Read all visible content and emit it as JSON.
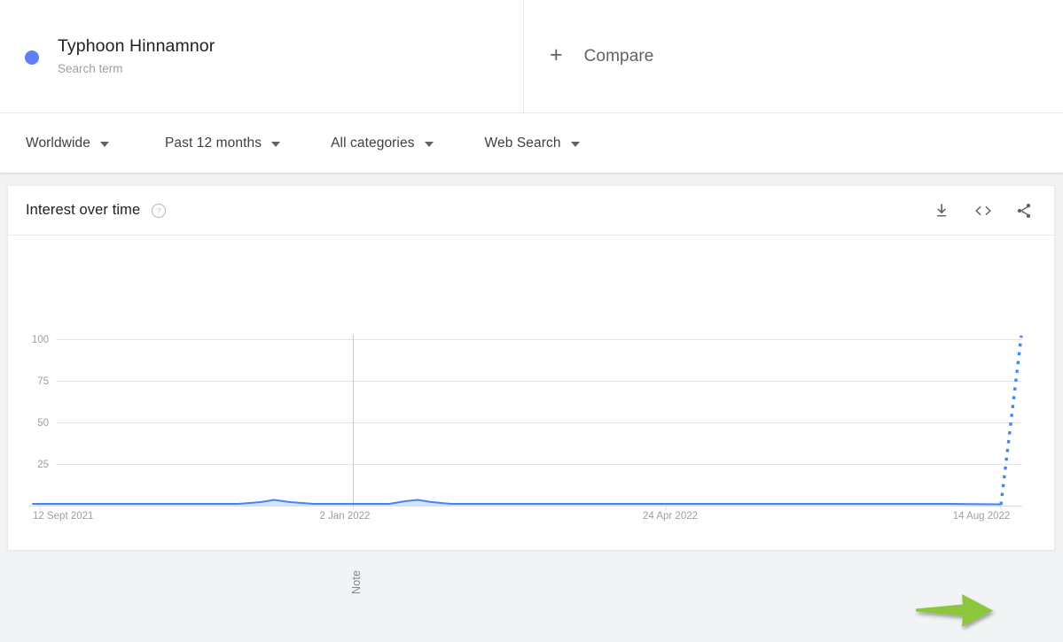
{
  "term": {
    "name": "Typhoon Hinnamnor",
    "type_label": "Search term",
    "dot_color": "#5f80f2"
  },
  "compare": {
    "plus_glyph": "+",
    "label": "Compare"
  },
  "filters": [
    {
      "label": "Worldwide",
      "icon": "chevron-down-icon"
    },
    {
      "label": "Past 12 months",
      "icon": "chevron-down-icon"
    },
    {
      "label": "All categories",
      "icon": "chevron-down-icon"
    },
    {
      "label": "Web Search",
      "icon": "chevron-down-icon"
    }
  ],
  "card": {
    "title": "Interest over time",
    "help_icon": "help-circle-icon",
    "actions": [
      {
        "name": "download-icon",
        "label": "Download"
      },
      {
        "name": "embed-code-icon",
        "label": "Embed"
      },
      {
        "name": "share-icon",
        "label": "Share"
      }
    ]
  },
  "annotation": {
    "note_label": "Note",
    "arrow_color": "#8cc63e",
    "arrow_name": "green-highlight-arrow"
  },
  "chart_data": {
    "type": "line",
    "title": "Interest over time",
    "series": [
      {
        "name": "Typhoon Hinnamnor",
        "color": "#4285f4",
        "values": [
          1,
          1,
          1,
          1,
          1,
          1,
          1,
          1,
          1,
          1,
          1,
          1,
          1,
          1,
          2,
          3,
          2,
          1,
          1,
          1,
          1,
          1,
          1,
          1,
          1,
          1,
          1,
          1,
          1,
          2,
          3,
          2,
          1,
          1,
          1,
          1,
          1,
          1,
          1,
          1,
          1,
          1,
          1,
          1,
          1,
          1,
          1,
          1,
          1,
          1,
          1,
          100
        ]
      }
    ],
    "x": [
      "12 Sept 2021",
      "19 Sept 2021",
      "26 Sept 2021",
      "3 Oct 2021",
      "10 Oct 2021",
      "17 Oct 2021",
      "24 Oct 2021",
      "31 Oct 2021",
      "7 Nov 2021",
      "14 Nov 2021",
      "21 Nov 2021",
      "28 Nov 2021",
      "5 Dec 2021",
      "12 Dec 2021",
      "19 Dec 2021",
      "26 Dec 2021",
      "2 Jan 2022",
      "9 Jan 2022",
      "16 Jan 2022",
      "23 Jan 2022",
      "30 Jan 2022",
      "6 Feb 2022",
      "13 Feb 2022",
      "20 Feb 2022",
      "27 Feb 2022",
      "6 Mar 2022",
      "13 Mar 2022",
      "20 Mar 2022",
      "27 Mar 2022",
      "3 Apr 2022",
      "10 Apr 2022",
      "17 Apr 2022",
      "24 Apr 2022",
      "1 May 2022",
      "8 May 2022",
      "15 May 2022",
      "22 May 2022",
      "29 May 2022",
      "5 Jun 2022",
      "12 Jun 2022",
      "19 Jun 2022",
      "26 Jun 2022",
      "3 Jul 2022",
      "10 Jul 2022",
      "17 Jul 2022",
      "24 Jul 2022",
      "31 Jul 2022",
      "7 Aug 2022",
      "14 Aug 2022",
      "21 Aug 2022",
      "28 Aug 2022",
      "4 Sept 2022"
    ],
    "xtick_labels": [
      "12 Sept 2021",
      "2 Jan 2022",
      "24 Apr 2022",
      "14 Aug 2022"
    ],
    "ytick_labels": [
      "100",
      "75",
      "50",
      "25"
    ],
    "ylim": [
      0,
      100
    ],
    "grid": true,
    "legend": false,
    "xlabel": "",
    "ylabel": "",
    "annotations": [
      {
        "label": "Note",
        "x": "2 Jan 2022",
        "type": "vertical-marker"
      }
    ]
  }
}
